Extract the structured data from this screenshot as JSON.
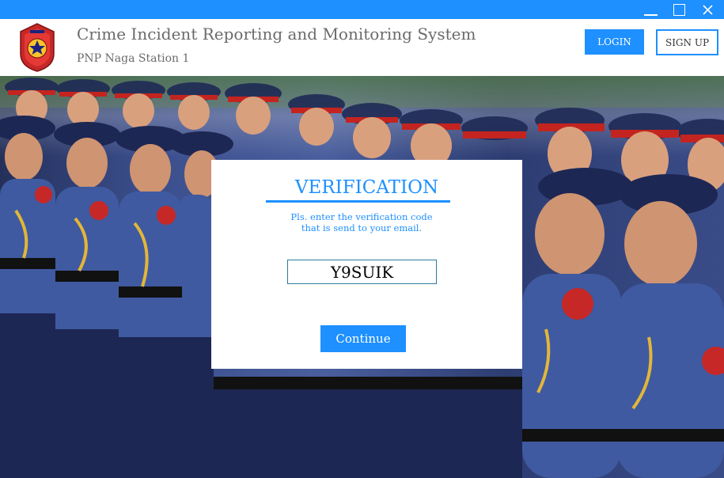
{
  "window": {
    "controls": [
      "minimize-icon",
      "maximize-icon",
      "close-icon"
    ],
    "bar_color": "#1e90ff"
  },
  "header": {
    "title": "Crime Incident Reporting and Monitoring System",
    "subtitle": "PNP Naga Station 1",
    "login_label": "LOGIN",
    "signup_label": "SIGN UP",
    "logo_icon": "pnp-badge-icon"
  },
  "verification": {
    "title": "VERIFICATION",
    "message_line1": "Pls. enter the verification code",
    "message_line2": "that is send to your email.",
    "code_value": "Y9SUIK",
    "continue_label": "Continue"
  },
  "colors": {
    "accent": "#1e90ff",
    "text_muted": "#6b6b6b"
  }
}
